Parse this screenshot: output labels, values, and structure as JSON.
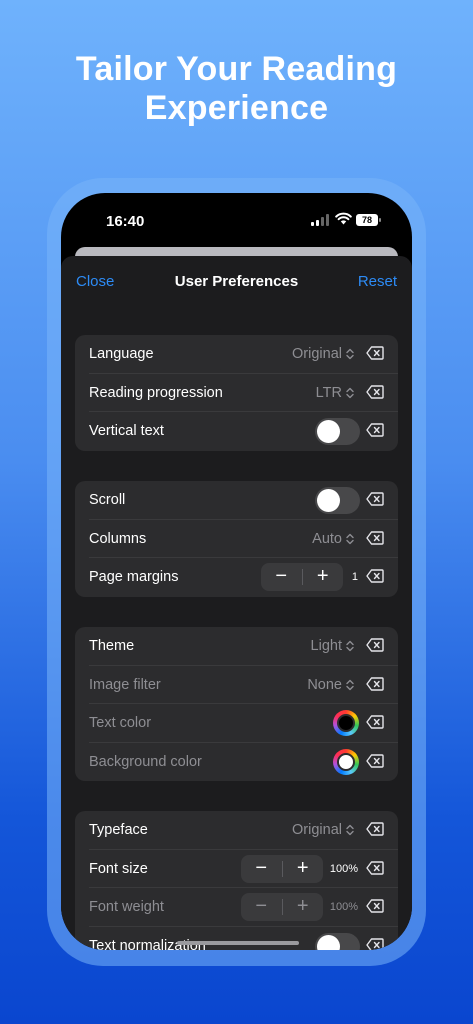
{
  "headline": {
    "line1": "Tailor Your Reading",
    "line2": "Experience"
  },
  "status_bar": {
    "time": "16:40",
    "battery": "78"
  },
  "nav": {
    "close": "Close",
    "title": "User Preferences",
    "reset": "Reset"
  },
  "groups": [
    {
      "rows": [
        {
          "label": "Language",
          "value": "Original",
          "control": "picker"
        },
        {
          "label": "Reading progression",
          "value": "LTR",
          "control": "picker"
        },
        {
          "label": "Vertical text",
          "control": "toggle",
          "on": false
        }
      ]
    },
    {
      "rows": [
        {
          "label": "Scroll",
          "control": "toggle",
          "on": false
        },
        {
          "label": "Columns",
          "value": "Auto",
          "control": "picker"
        },
        {
          "label": "Page margins",
          "control": "stepper",
          "value": "1"
        }
      ]
    },
    {
      "rows": [
        {
          "label": "Theme",
          "value": "Light",
          "control": "picker"
        },
        {
          "label": "Image filter",
          "value": "None",
          "control": "picker",
          "disabled": true
        },
        {
          "label": "Text color",
          "control": "color",
          "color": "#000000",
          "disabled": true
        },
        {
          "label": "Background color",
          "control": "color",
          "color": "#ffffff",
          "disabled": true
        }
      ]
    },
    {
      "rows": [
        {
          "label": "Typeface",
          "value": "Original",
          "control": "picker"
        },
        {
          "label": "Font size",
          "control": "stepper",
          "value": "100%"
        },
        {
          "label": "Font weight",
          "control": "stepper",
          "value": "100%",
          "disabled": true
        },
        {
          "label": "Text normalization",
          "control": "toggle",
          "on": false
        }
      ]
    }
  ],
  "stepper_minus": "−",
  "stepper_plus": "+",
  "colors": {
    "accent": "#2d8bf5",
    "sheet": "#1c1c1e",
    "cell": "#2c2c2e",
    "secondary_text": "#8e8e93"
  }
}
